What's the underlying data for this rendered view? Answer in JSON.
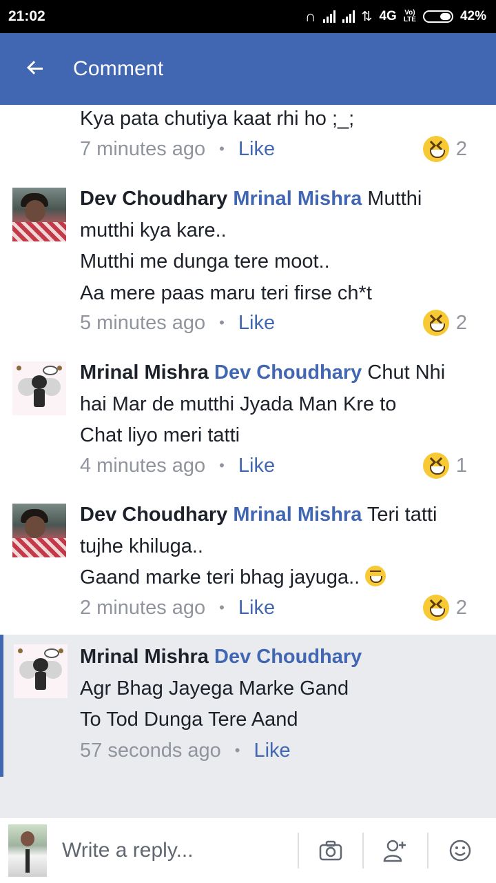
{
  "status_bar": {
    "time": "21:02",
    "network": "4G",
    "volte": "Vo LTE",
    "battery": "42%",
    "battery_level": 0.42
  },
  "app_bar": {
    "title": "Comment",
    "back_icon": "arrow-left-icon"
  },
  "comments": [
    {
      "author": "",
      "mention": "",
      "lines": [
        "Kya pata chutiya kaat rhi ho ;_;"
      ],
      "time": "7 minutes ago",
      "like_label": "Like",
      "reaction_icon": "laughing-emoji-icon",
      "reaction_count": "2"
    },
    {
      "author": "Dev Choudhary",
      "mention": "Mrinal Mishra",
      "first_line_text": "Mutthi",
      "lines": [
        "mutthi kya kare..",
        "Mutthi me dunga tere moot..",
        "Aa mere paas maru teri firse ch*t"
      ],
      "time": "5 minutes ago",
      "like_label": "Like",
      "reaction_icon": "laughing-emoji-icon",
      "reaction_count": "2"
    },
    {
      "author": "Mrinal Mishra",
      "mention": "Dev Choudhary",
      "first_line_text": "Chut Nhi",
      "lines": [
        "hai Mar de mutthi Jyada Man Kre to",
        "Chat liyo meri tatti"
      ],
      "time": "4 minutes ago",
      "like_label": "Like",
      "reaction_icon": "laughing-emoji-icon",
      "reaction_count": "1"
    },
    {
      "author": "Dev Choudhary",
      "mention": "Mrinal Mishra",
      "first_line_text": "Teri tatti",
      "lines": [
        "tujhe khiluga..",
        "Gaand marke teri bhag jayuga.."
      ],
      "time": "2 minutes ago",
      "like_label": "Like",
      "reaction_icon": "laughing-emoji-icon",
      "reaction_count": "2"
    },
    {
      "author": "Mrinal Mishra",
      "mention": "Dev Choudhary",
      "first_line_text": "",
      "lines": [
        "Agr Bhag Jayega Marke Gand",
        "To Tod Dunga Tere Aand"
      ],
      "time": "57 seconds ago",
      "like_label": "Like"
    }
  ],
  "reply_bar": {
    "placeholder": "Write a reply...",
    "icons": [
      "camera-icon",
      "add-person-icon",
      "smiley-icon"
    ]
  },
  "colors": {
    "accent": "#4267b2",
    "status_bar": "#000000",
    "meta_text": "#90949c",
    "highlight_bg": "#e9ebee",
    "reaction_yellow": "#f7c935"
  }
}
